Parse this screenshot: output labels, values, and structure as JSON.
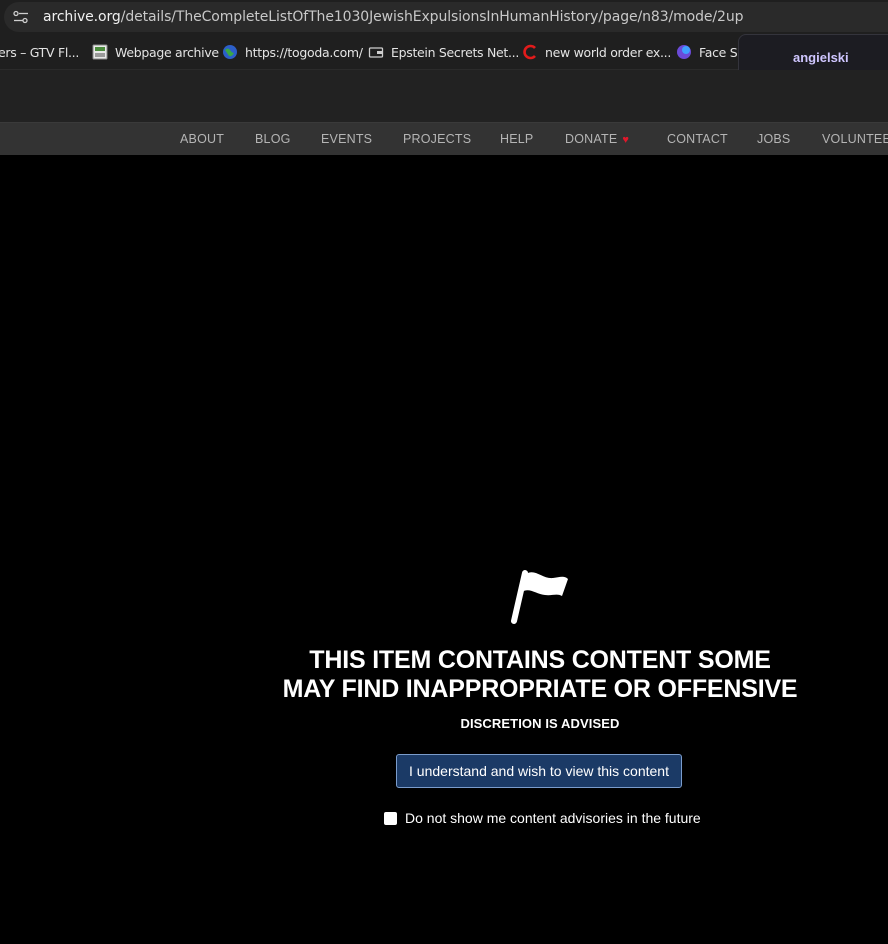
{
  "browser": {
    "url_host": "archive.org",
    "url_path": "/details/TheCompleteListOfThe1030JewishExpulsionsInHumanHistory/page/n83/mode/2up",
    "bookmarks": [
      {
        "label": "ers – GTV Fl...",
        "icon": "page-icon"
      },
      {
        "label": "Webpage archive",
        "icon": "archive-icon"
      },
      {
        "label": "https://togoda.com/",
        "icon": "globe-icon"
      },
      {
        "label": "Epstein Secrets Net...",
        "icon": "folder-icon"
      },
      {
        "label": "new world order ex...",
        "icon": "red-c-icon"
      },
      {
        "label": "Face Sw",
        "icon": "face-swap-icon"
      }
    ],
    "popup_label": "angielski"
  },
  "nav": {
    "items": [
      "ABOUT",
      "BLOG",
      "EVENTS",
      "PROJECTS",
      "HELP",
      "DONATE",
      "CONTACT",
      "JOBS",
      "VOLUNTEER"
    ],
    "donate_heart": "♥"
  },
  "advisory": {
    "headline_line1": "THIS ITEM CONTAINS CONTENT SOME",
    "headline_line2": "MAY FIND INAPPROPRIATE OR OFFENSIVE",
    "subhead": "DISCRETION IS ADVISED",
    "button_label": "I understand and wish to view this content",
    "optout_label": "Do not show me content advisories in the future",
    "optout_checked": false
  },
  "colors": {
    "button_bg": "#1b3a66",
    "heart": "#e0182b",
    "popup_accent": "#c7bdfc"
  }
}
